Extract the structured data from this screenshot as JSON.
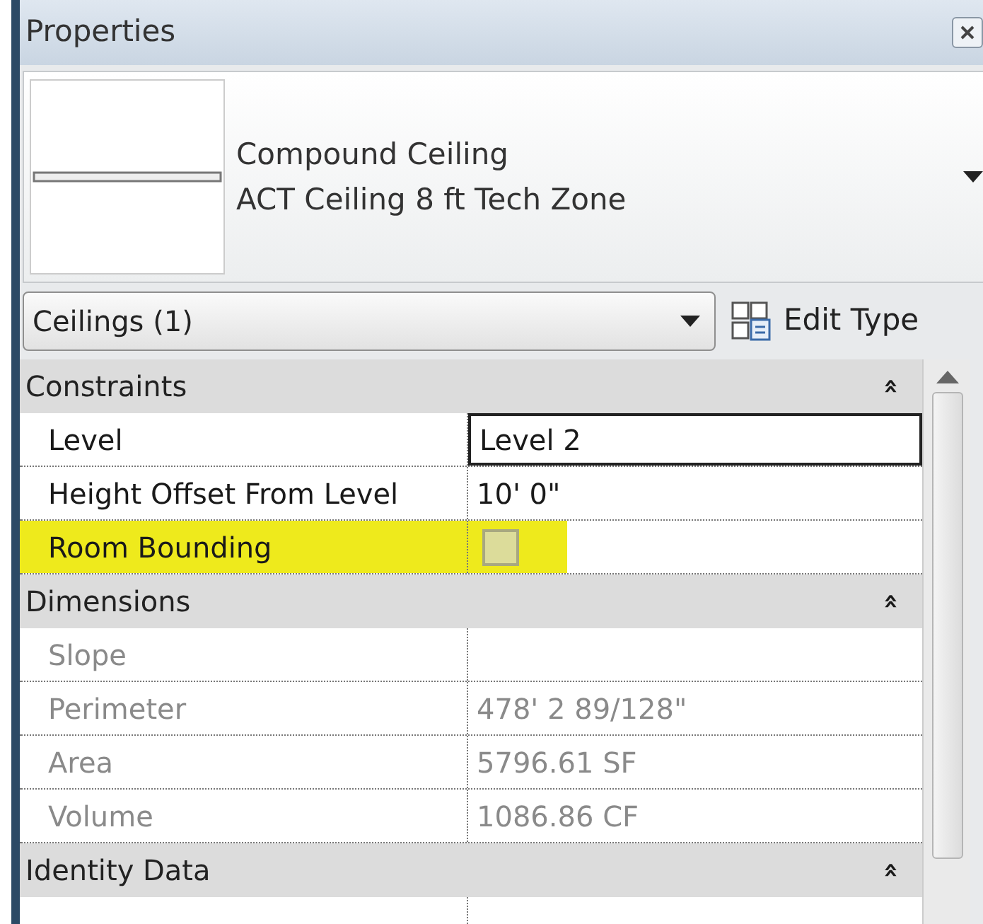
{
  "panel": {
    "title": "Properties"
  },
  "type_selector": {
    "family": "Compound Ceiling",
    "type": "ACT Ceiling 8 ft Tech Zone"
  },
  "instance_filter": {
    "value": "Ceilings (1)"
  },
  "edit_type_button": {
    "label": "Edit Type"
  },
  "groups": [
    {
      "title": "Constraints",
      "expanded": true,
      "collapse_glyph": "»",
      "rows": [
        {
          "kind": "text",
          "label": "Level",
          "value": "Level 2",
          "read_only": false,
          "editing": true,
          "highlighted": false
        },
        {
          "kind": "text",
          "label": "Height Offset From Level",
          "value": "10'  0\"",
          "read_only": false,
          "editing": false,
          "highlighted": false
        },
        {
          "kind": "checkbox",
          "label": "Room Bounding",
          "checked": false,
          "read_only": false,
          "editing": false,
          "highlighted": true
        }
      ]
    },
    {
      "title": "Dimensions",
      "expanded": true,
      "collapse_glyph": "»",
      "rows": [
        {
          "kind": "text",
          "label": "Slope",
          "value": "",
          "read_only": true,
          "editing": false,
          "highlighted": false
        },
        {
          "kind": "text",
          "label": "Perimeter",
          "value": "478'  2 89/128\"",
          "read_only": true,
          "editing": false,
          "highlighted": false
        },
        {
          "kind": "text",
          "label": "Area",
          "value": "5796.61 SF",
          "read_only": true,
          "editing": false,
          "highlighted": false
        },
        {
          "kind": "text",
          "label": "Volume",
          "value": "1086.86 CF",
          "read_only": true,
          "editing": false,
          "highlighted": false
        }
      ]
    },
    {
      "title": "Identity Data",
      "expanded": true,
      "collapse_glyph": "»"
    }
  ]
}
